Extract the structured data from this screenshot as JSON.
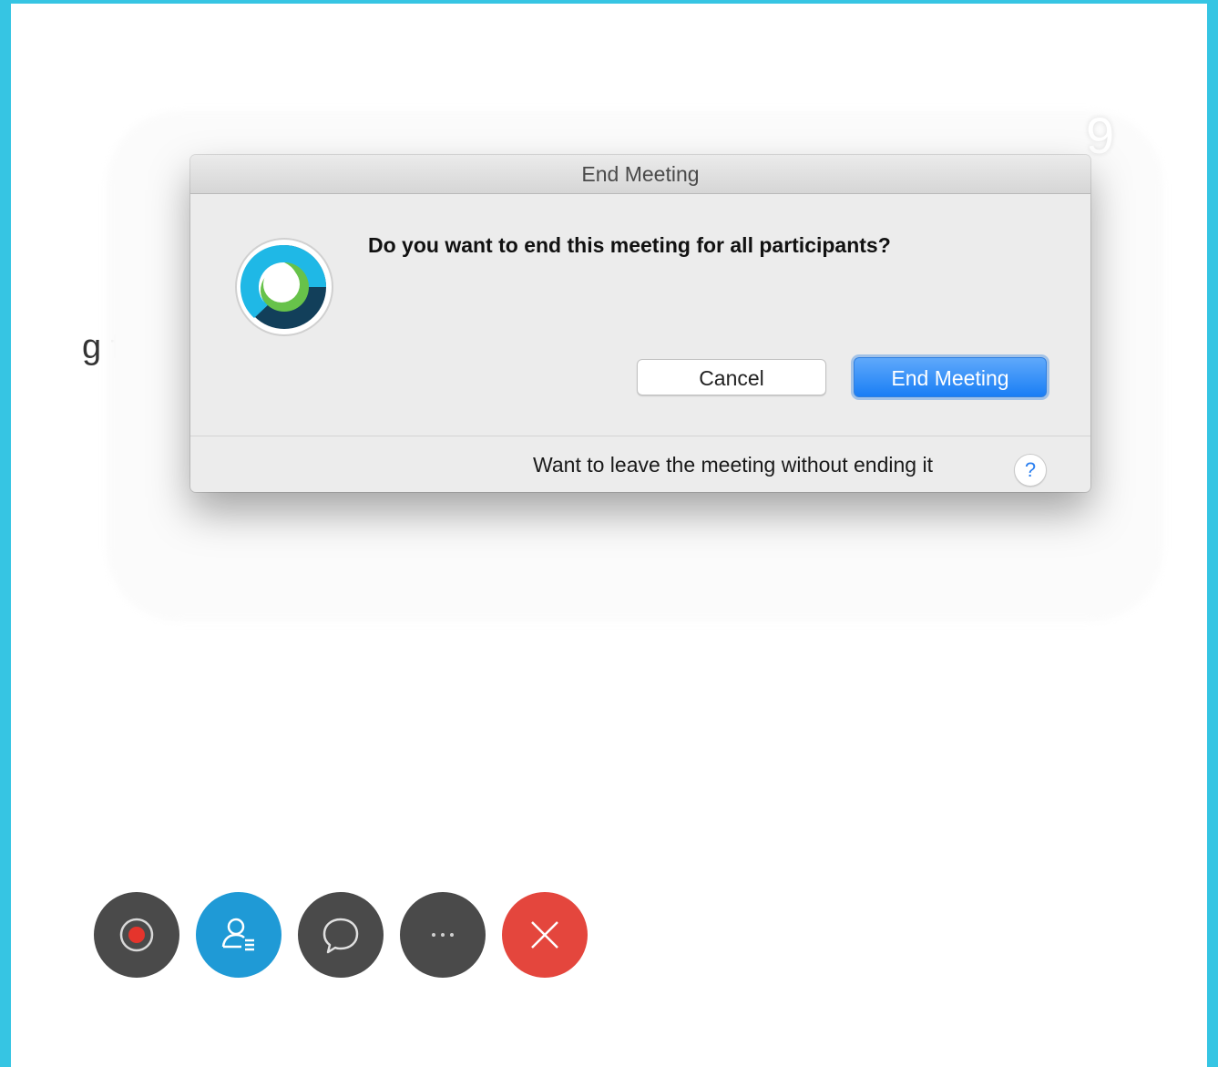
{
  "background": {
    "partial_text": "g for c"
  },
  "dialog": {
    "title": "End Meeting",
    "message": "Do you want to end this meeting for all participants?",
    "cancel_label": "Cancel",
    "confirm_label": "End Meeting",
    "leave_text": "Want to leave the meeting without ending it",
    "help_label": "?"
  },
  "toolbar": {
    "buttons": [
      {
        "icon": "record-icon",
        "color": "#4a4a4a"
      },
      {
        "icon": "participants-icon",
        "color": "#1f9ad6"
      },
      {
        "icon": "chat-icon",
        "color": "#4a4a4a"
      },
      {
        "icon": "more-icon",
        "color": "#4a4a4a"
      },
      {
        "icon": "close-icon",
        "color": "#e4463d"
      }
    ]
  },
  "colors": {
    "frame": "#36c5e3",
    "primary_button": "#1a7ef5",
    "record_dot": "#e5342c"
  }
}
